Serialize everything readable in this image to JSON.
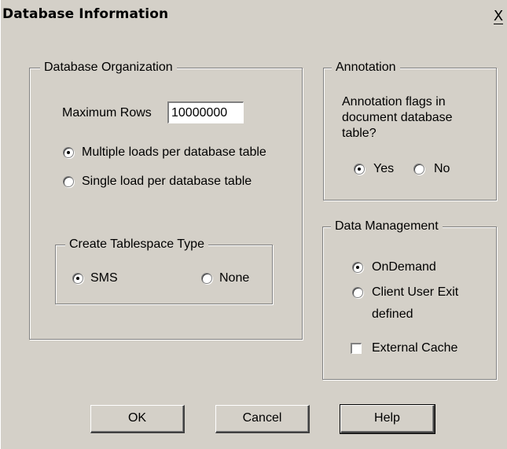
{
  "window": {
    "title": "Database Information",
    "close_glyph": "X"
  },
  "database_organization": {
    "legend": "Database Organization",
    "max_rows_label": "Maximum Rows",
    "max_rows_value": "10000000",
    "load_options": [
      {
        "label": "Multiple loads per database table",
        "checked": true
      },
      {
        "label": "Single load per database table",
        "checked": false
      }
    ],
    "tablespace": {
      "legend": "Create Tablespace Type",
      "options": [
        {
          "label": "SMS",
          "checked": true
        },
        {
          "label": "None",
          "checked": false
        }
      ]
    }
  },
  "annotation": {
    "legend": "Annotation",
    "question_lines": [
      "Annotation flags in",
      "document database",
      "table?"
    ],
    "options": [
      {
        "label": "Yes",
        "checked": true
      },
      {
        "label": "No",
        "checked": false
      }
    ]
  },
  "data_management": {
    "legend": "Data Management",
    "options": [
      {
        "label": "OnDemand",
        "checked": true
      },
      {
        "label": "Client User Exit",
        "checked": false
      }
    ],
    "client_user_exit_line2": "defined",
    "external_cache_label": "External Cache",
    "external_cache_checked": false
  },
  "buttons": {
    "ok": "OK",
    "cancel": "Cancel",
    "help": "Help"
  },
  "colors": {
    "dialog_background": "#d4d0c8",
    "shadow": "#808080",
    "highlight": "#ffffff"
  }
}
